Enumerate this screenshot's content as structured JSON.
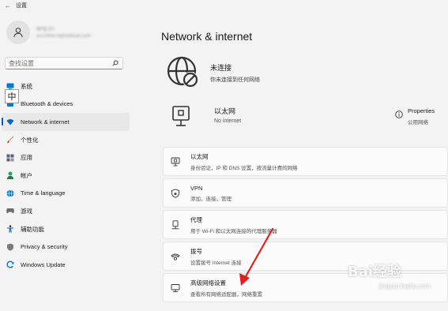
{
  "window": {
    "title": "设置",
    "back_glyph": "←"
  },
  "profile": {
    "name": "qing yu",
    "email": "a12345678@outlook.com"
  },
  "search": {
    "placeholder": "查找设置"
  },
  "ime_indicator": "中",
  "nav": {
    "items": [
      {
        "label": "系统",
        "icon": "system-icon",
        "color": "#0078d4"
      },
      {
        "label": "Bluetooth & devices",
        "icon": "bluetooth-icon",
        "color": "#0078d4"
      },
      {
        "label": "Network & internet",
        "icon": "wifi-icon",
        "color": "#0067c0",
        "active": true
      },
      {
        "label": "个性化",
        "icon": "brush-icon",
        "color": "#e08a2e"
      },
      {
        "label": "应用",
        "icon": "apps-icon",
        "color": "#5a6270"
      },
      {
        "label": "帐户",
        "icon": "account-icon",
        "color": "#2aa06a"
      },
      {
        "label": "Time & language",
        "icon": "globe-icon",
        "color": "#0078d4"
      },
      {
        "label": "游戏",
        "icon": "gamepad-icon",
        "color": "#6b6b6b"
      },
      {
        "label": "辅助功能",
        "icon": "accessibility-icon",
        "color": "#1a1a1a"
      },
      {
        "label": "Privacy & security",
        "icon": "shield-icon",
        "color": "#6b6b6b"
      },
      {
        "label": "Windows Update",
        "icon": "update-icon",
        "color": "#0078d4"
      }
    ]
  },
  "main": {
    "title": "Network & internet",
    "status": {
      "title": "未连接",
      "subtitle": "你未连接到任何网络",
      "icon": "globe-disconnected-icon"
    },
    "ethernet": {
      "title": "以太网",
      "subtitle": "No internet",
      "icon": "ethernet-icon"
    },
    "properties": {
      "title": "Properties",
      "subtitle": "公用网络",
      "icon": "info-icon"
    },
    "cards": [
      {
        "title": "以太网",
        "subtitle": "身份验证，IP 和 DNS 设置，按流量计费的网络",
        "icon": "ethernet-icon"
      },
      {
        "title": "VPN",
        "subtitle": "添加，连接，管理",
        "icon": "vpn-shield-icon"
      },
      {
        "title": "代理",
        "subtitle": "用于 Wi-Fi 和以太网连接的代理服务器",
        "icon": "proxy-icon"
      },
      {
        "title": "拨号",
        "subtitle": "设置拨号 Internet 连接",
        "icon": "dialup-icon"
      },
      {
        "title": "高级网络设置",
        "subtitle": "查看所有网络适配器，网络重置",
        "icon": "network-adapter-icon"
      }
    ]
  },
  "annotation": {
    "arrow_color": "#e02020"
  },
  "watermark": {
    "text": "Bai经验",
    "url": "jingyan.baidu.com"
  }
}
